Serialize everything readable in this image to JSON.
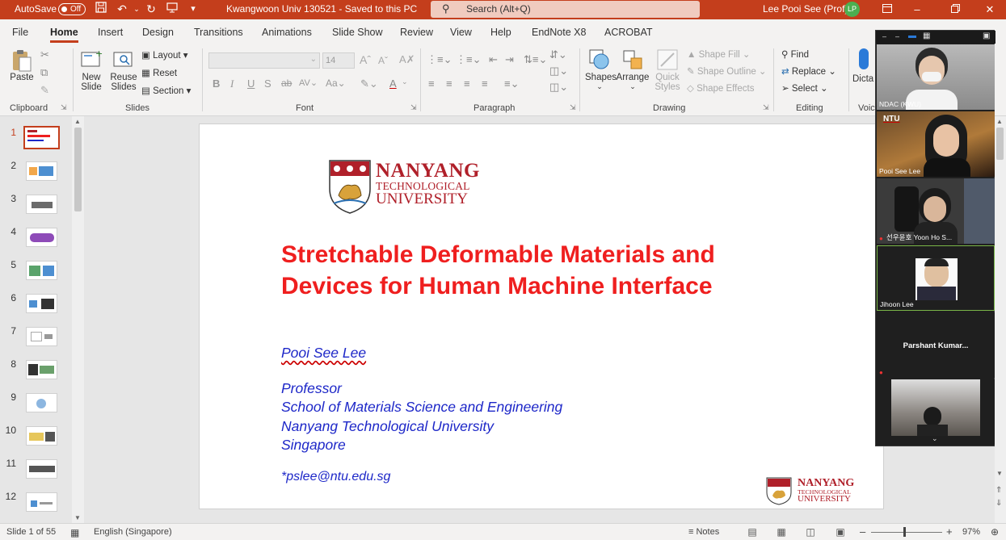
{
  "titlebar": {
    "autosave_label": "AutoSave",
    "autosave_state": "Off",
    "doc_title": "Kwangwoon Univ 130521  -  Saved to this PC",
    "search_placeholder": "Search (Alt+Q)",
    "user_name": "Lee Pooi See (Prof)",
    "user_initials": "LP",
    "accent_color": "#c43e1c"
  },
  "tabs": [
    "File",
    "Home",
    "Insert",
    "Design",
    "Transitions",
    "Animations",
    "Slide Show",
    "Review",
    "View",
    "Help",
    "EndNote X8",
    "ACROBAT"
  ],
  "active_tab": "Home",
  "ribbon": {
    "clipboard": {
      "label": "Clipboard",
      "paste": "Paste"
    },
    "slides": {
      "label": "Slides",
      "new_slide": "New",
      "new_slide2": "Slide",
      "reuse": "Reuse",
      "reuse2": "Slides",
      "layout": "Layout",
      "reset": "Reset",
      "section": "Section"
    },
    "font": {
      "label": "Font",
      "size": "14"
    },
    "paragraph": {
      "label": "Paragraph"
    },
    "drawing": {
      "label": "Drawing",
      "shapes": "Shapes",
      "arrange": "Arrange",
      "quick_styles": "Quick",
      "quick_styles2": "Styles",
      "shape_fill": "Shape Fill",
      "shape_outline": "Shape Outline",
      "shape_effects": "Shape Effects"
    },
    "editing": {
      "label": "Editing",
      "find": "Find",
      "replace": "Replace",
      "select": "Select"
    },
    "voice": {
      "label": "Voic",
      "dictate": "Dicta"
    }
  },
  "thumbnails": [
    "1",
    "2",
    "3",
    "4",
    "5",
    "6",
    "7",
    "8",
    "9",
    "10",
    "11",
    "12"
  ],
  "slide": {
    "logo_line1": "NANYANG",
    "logo_line2": "TECHNOLOGICAL",
    "logo_line3": "UNIVERSITY",
    "title_line1": "Stretchable Deformable Materials and",
    "title_line2": "Devices for Human Machine Interface",
    "author": "Pooi See Lee",
    "position": "Professor",
    "school": "School of Materials Science and Engineering",
    "university": "Nanyang Technological University",
    "country": "Singapore",
    "email": "*pslee@ntu.edu.sg",
    "title_color": "#ef1f1f",
    "body_color": "#1d27c8"
  },
  "zoom_panel": {
    "participants": [
      {
        "name": "NDAC (KWU)"
      },
      {
        "name": "Pooi See Lee",
        "badge": "NTU"
      },
      {
        "name": "선우윤호 Yoon Ho S..."
      },
      {
        "name": "Jihoon Lee"
      },
      {
        "name": "Parshant  Kumar..."
      },
      {
        "name": ""
      }
    ]
  },
  "statusbar": {
    "slide_info": "Slide 1 of 55",
    "language": "English (Singapore)",
    "notes": "Notes",
    "zoom": "97%"
  }
}
